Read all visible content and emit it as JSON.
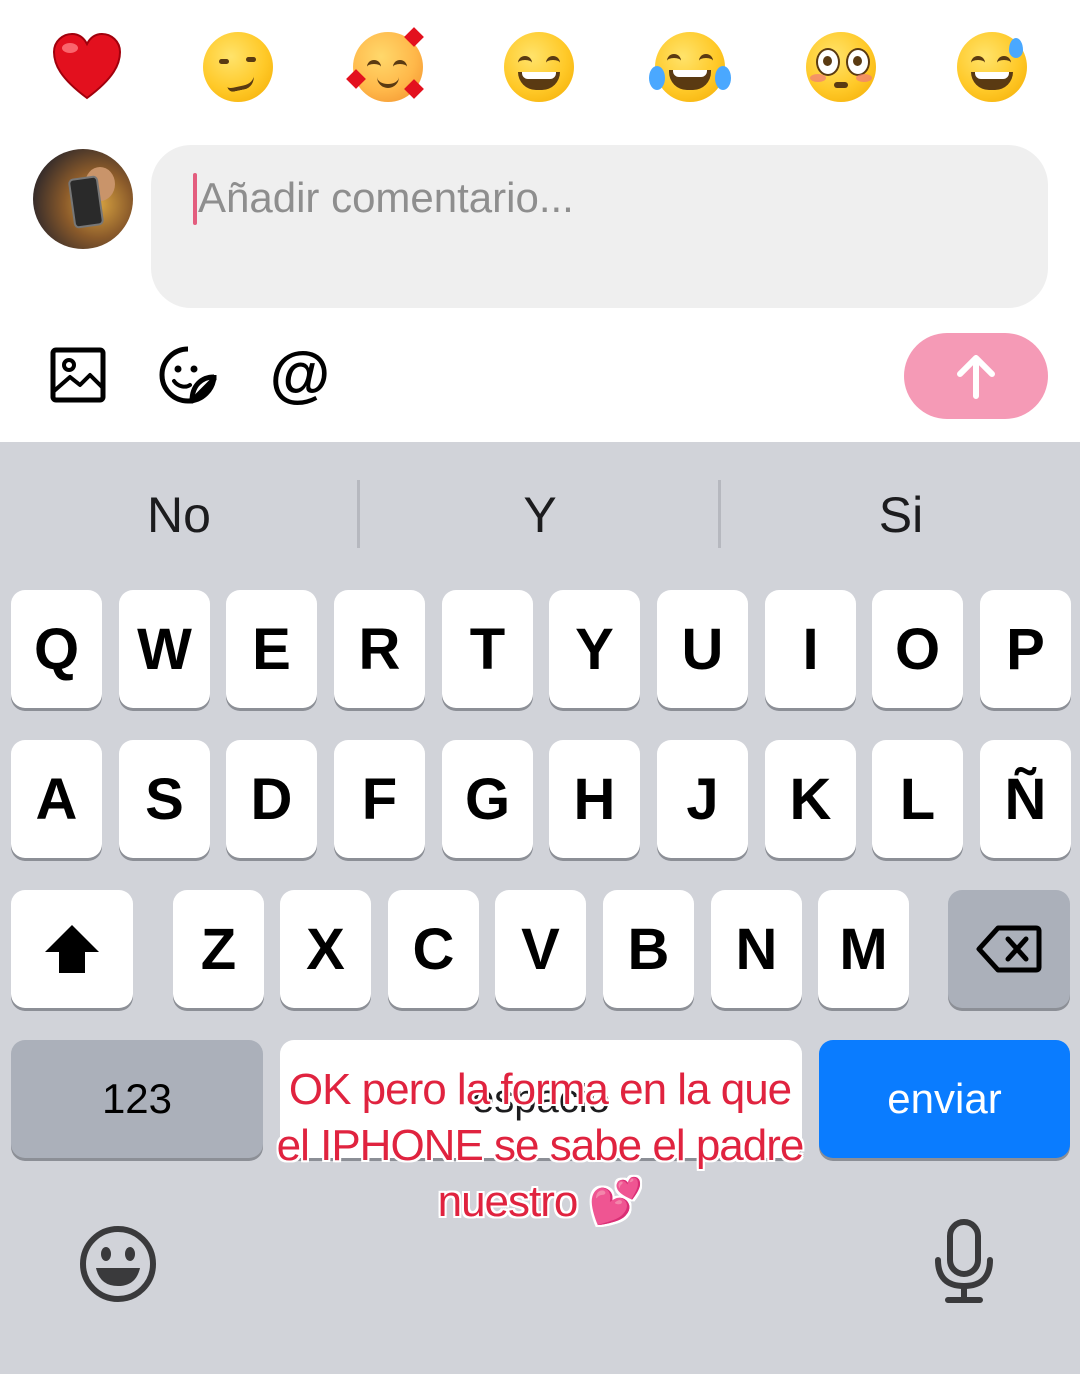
{
  "emoji_reactions": [
    "red-heart",
    "smirking-face",
    "smiling-face-with-hearts",
    "beaming-face",
    "face-with-tears-of-joy",
    "flushed-face",
    "grinning-face-with-sweat"
  ],
  "comment": {
    "placeholder": "Añadir comentario..."
  },
  "toolbar": {
    "icons": [
      "image-icon",
      "sticker-icon",
      "mention-icon"
    ],
    "mention_symbol": "@",
    "send_icon": "arrow-up-icon"
  },
  "keyboard": {
    "suggestions": [
      "No",
      "Y",
      "Si"
    ],
    "row1": [
      "Q",
      "W",
      "E",
      "R",
      "T",
      "Y",
      "U",
      "I",
      "O",
      "P"
    ],
    "row2": [
      "A",
      "S",
      "D",
      "F",
      "G",
      "H",
      "J",
      "K",
      "L",
      "Ñ"
    ],
    "row3": [
      "Z",
      "X",
      "C",
      "V",
      "B",
      "N",
      "M"
    ],
    "numbers_key": "123",
    "space_key": "espacio",
    "return_key": "enviar"
  },
  "caption": "OK pero la forma en la que el IPHONE se sabe el padre nuestro 💕",
  "colors": {
    "send_button": "#f59ab6",
    "return_key": "#0a7cff",
    "caption_text": "#e0233f",
    "keyboard_bg": "#d1d3d9"
  }
}
